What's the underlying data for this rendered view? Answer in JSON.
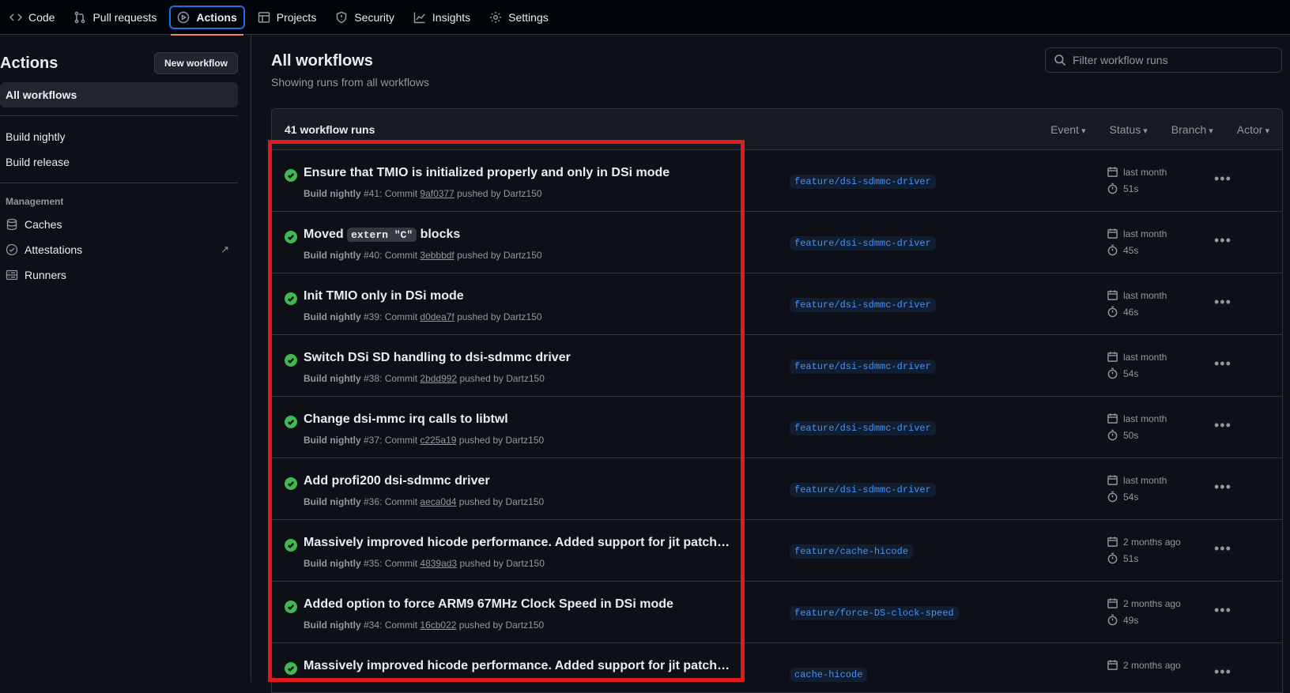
{
  "nav": {
    "items": [
      {
        "label": "Code",
        "icon": "code-icon"
      },
      {
        "label": "Pull requests",
        "icon": "pull-request-icon"
      },
      {
        "label": "Actions",
        "icon": "play-icon"
      },
      {
        "label": "Projects",
        "icon": "table-icon"
      },
      {
        "label": "Security",
        "icon": "shield-icon"
      },
      {
        "label": "Insights",
        "icon": "graph-icon"
      },
      {
        "label": "Settings",
        "icon": "gear-icon"
      }
    ],
    "active": "Actions"
  },
  "sidebar": {
    "title": "Actions",
    "new_workflow": "New workflow",
    "all_workflows": "All workflows",
    "workflows": [
      "Build nightly",
      "Build release"
    ],
    "management_label": "Management",
    "management": [
      {
        "label": "Caches",
        "icon": "database-icon"
      },
      {
        "label": "Attestations",
        "icon": "verified-icon"
      },
      {
        "label": "Runners",
        "icon": "server-icon"
      }
    ]
  },
  "main": {
    "title": "All workflows",
    "subtitle": "Showing runs from all workflows",
    "filter_placeholder": "Filter workflow runs",
    "run_count": "41 workflow runs",
    "filters": [
      "Event",
      "Status",
      "Branch",
      "Actor"
    ]
  },
  "runs": [
    {
      "title": "Ensure that TMIO is initialized properly and only in DSi mode",
      "workflow": "Build nightly",
      "num": "#41",
      "commit": "9af0377",
      "author": "Dartz150",
      "branch": "feature/dsi-sdmmc-driver",
      "when": "last month",
      "duration": "51s"
    },
    {
      "title_pre": "Moved ",
      "title_code": "extern \"C\"",
      "title_post": " blocks",
      "workflow": "Build nightly",
      "num": "#40",
      "commit": "3ebbbdf",
      "author": "Dartz150",
      "branch": "feature/dsi-sdmmc-driver",
      "when": "last month",
      "duration": "45s"
    },
    {
      "title": "Init TMIO only in DSi mode",
      "workflow": "Build nightly",
      "num": "#39",
      "commit": "d0dea7f",
      "author": "Dartz150",
      "branch": "feature/dsi-sdmmc-driver",
      "when": "last month",
      "duration": "46s"
    },
    {
      "title": "Switch DSi SD handling to dsi-sdmmc driver",
      "workflow": "Build nightly",
      "num": "#38",
      "commit": "2bdd992",
      "author": "Dartz150",
      "branch": "feature/dsi-sdmmc-driver",
      "when": "last month",
      "duration": "54s"
    },
    {
      "title": "Change dsi-mmc irq calls to libtwl",
      "workflow": "Build nightly",
      "num": "#37",
      "commit": "c225a19",
      "author": "Dartz150",
      "branch": "feature/dsi-sdmmc-driver",
      "when": "last month",
      "duration": "50s"
    },
    {
      "title": "Add profi200 dsi-sdmmc driver",
      "workflow": "Build nightly",
      "num": "#36",
      "commit": "aeca0d4",
      "author": "Dartz150",
      "branch": "feature/dsi-sdmmc-driver",
      "when": "last month",
      "duration": "54s"
    },
    {
      "title": "Massively improved hicode performance. Added support for jit patches ...",
      "workflow": "Build nightly",
      "num": "#35",
      "commit": "4839ad3",
      "author": "Dartz150",
      "branch": "feature/cache-hicode",
      "when": "2 months ago",
      "duration": "51s"
    },
    {
      "title": "Added option to force ARM9 67MHz Clock Speed in DSi mode",
      "workflow": "Build nightly",
      "num": "#34",
      "commit": "16cb022",
      "author": "Dartz150",
      "branch": "feature/force-DS-clock-speed",
      "when": "2 months ago",
      "duration": "49s"
    },
    {
      "title": "Massively improved hicode performance. Added support for jit patches ...",
      "workflow": "",
      "num": "",
      "commit": "",
      "author": "",
      "branch": "cache-hicode",
      "when": "2 months ago",
      "duration": ""
    }
  ],
  "labels": {
    "commit": "Commit",
    "pushed_by": "pushed by"
  },
  "colors": {
    "success": "#3fb950",
    "highlight": "#e11b1b",
    "branch": "#4493f8",
    "accent": "#1f6feb"
  }
}
